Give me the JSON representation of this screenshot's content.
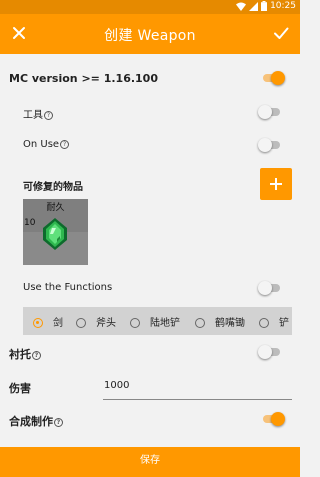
{
  "status": {
    "time": "10:25"
  },
  "appbar": {
    "title": "创建 Weapon"
  },
  "mc_version": {
    "label": "MC version >= 1.16.100",
    "enabled": true
  },
  "tool": {
    "label": "工具",
    "enabled": false
  },
  "on_use": {
    "label": "On Use",
    "enabled": false
  },
  "repairable": {
    "label": "可修复的物品",
    "add_icon": "plus-icon"
  },
  "repair_item": {
    "name": "耐久",
    "count": "10",
    "icon": "emerald-icon"
  },
  "use_functions": {
    "label": "Use the Functions",
    "enabled": false
  },
  "tool_types": {
    "selected": "剑",
    "options": [
      "剑",
      "斧头",
      "陆地铲",
      "鹤嘴锄",
      "铲"
    ]
  },
  "hand_equipped": {
    "label": "衬托",
    "enabled": false
  },
  "damage": {
    "label": "伤害",
    "value": "1000"
  },
  "crafting": {
    "label": "合成制作",
    "enabled": true
  },
  "save": {
    "label": "保存"
  },
  "colors": {
    "accent": "#ff9800",
    "status_bar": "#e68a00",
    "background": "#f2f2f2"
  }
}
